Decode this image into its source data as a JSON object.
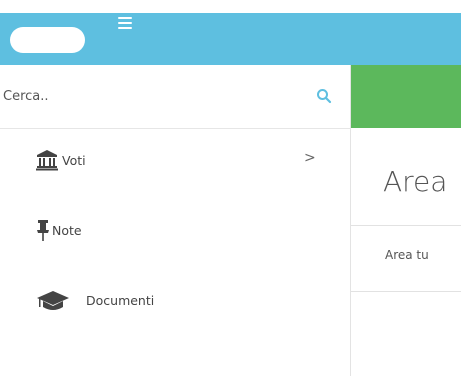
{
  "sidebar": {
    "search": {
      "placeholder": "Cerca.."
    },
    "items": [
      {
        "label": "Voti",
        "icon": "university-icon",
        "has_submenu": true
      },
      {
        "label": "Note",
        "icon": "thumbtack-icon",
        "has_submenu": false
      },
      {
        "label": "Documenti",
        "icon": "graduation-cap-icon",
        "has_submenu": false
      }
    ],
    "submenu_indicator": ">"
  },
  "main": {
    "title": "Area",
    "breadcrumb": "Area tu"
  },
  "colors": {
    "topbar": "#5ebfe0",
    "accent_bar": "#5cb85c",
    "search_icon": "#5ebfe0"
  }
}
